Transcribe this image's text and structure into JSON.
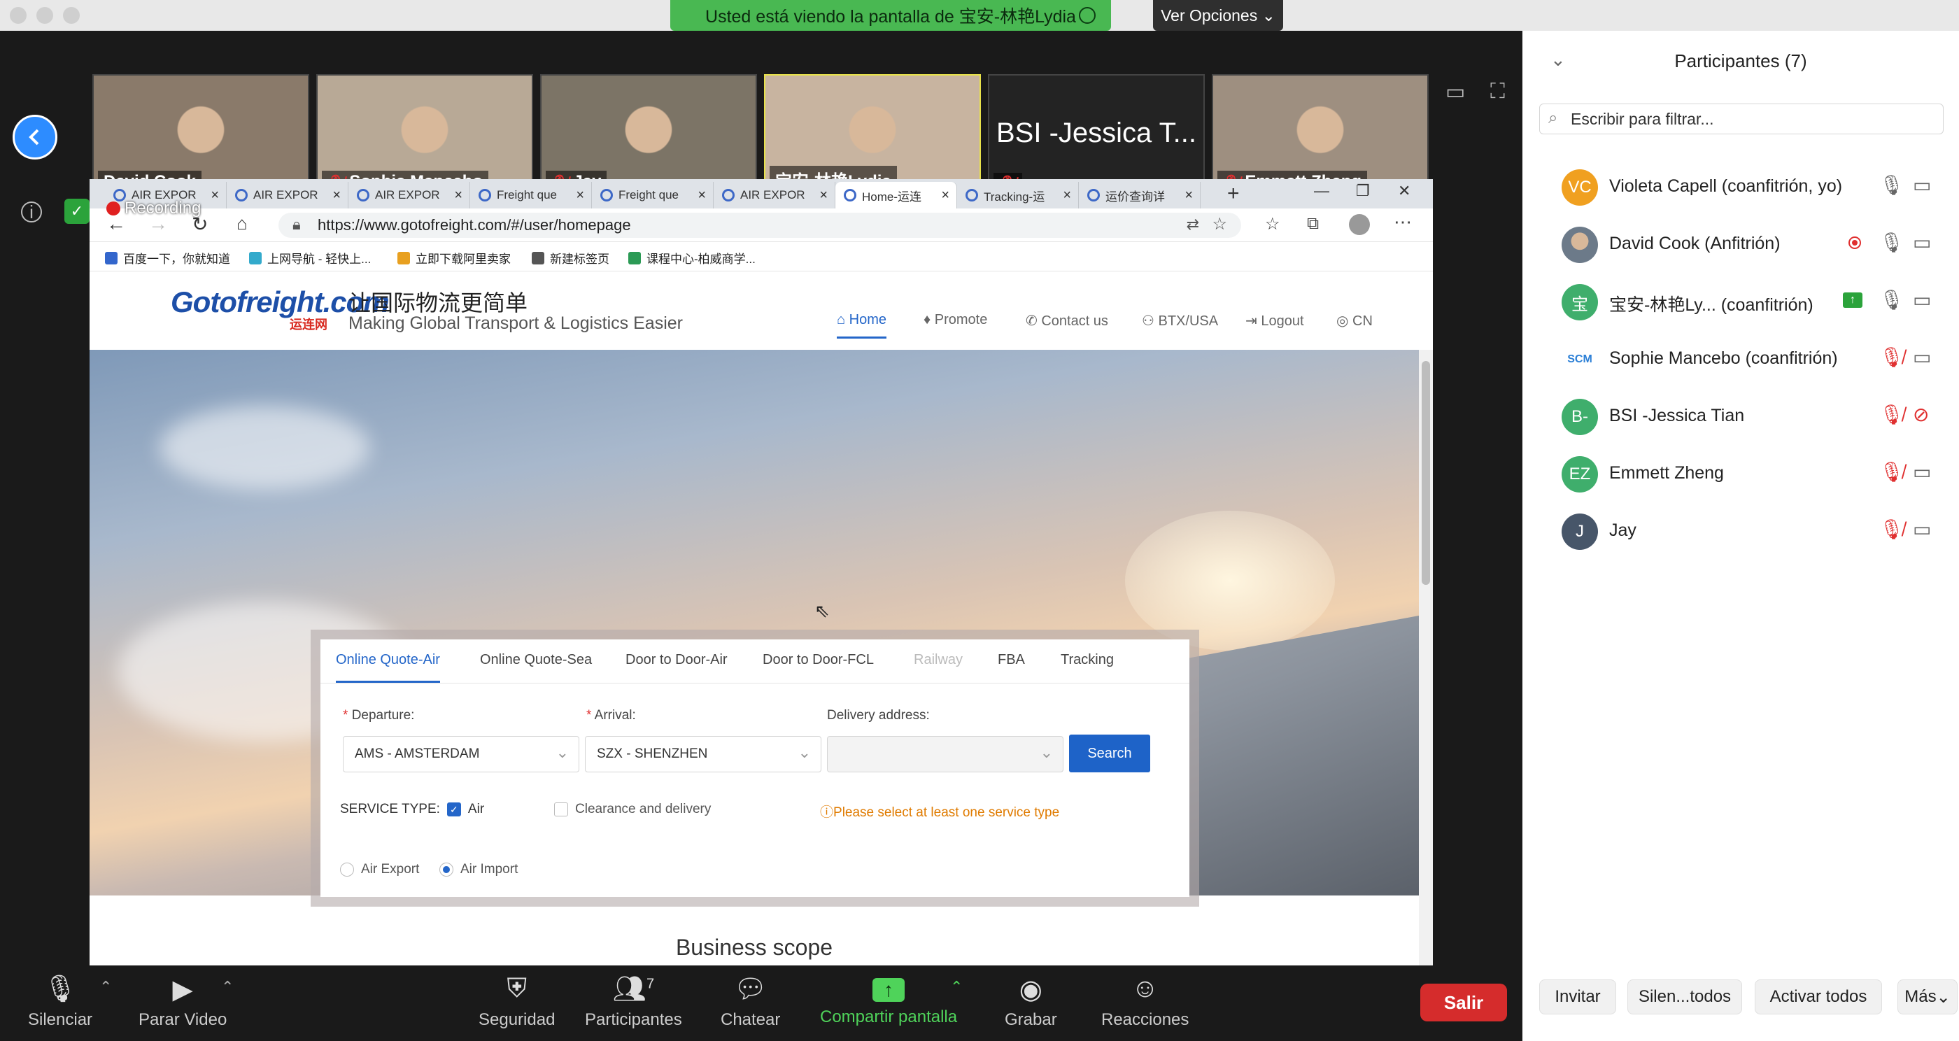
{
  "banner": {
    "text": "Usted está viendo la pantalla de 宝安-林艳Lydia",
    "options": "Ver Opciones"
  },
  "gallery": [
    {
      "name": "David Cook",
      "muted": false,
      "color": "#8a7a6a"
    },
    {
      "name": "Sophie Mancebo",
      "muted": true,
      "color": "#b8a996"
    },
    {
      "name": "Jay",
      "muted": true,
      "color": "#7c7466"
    },
    {
      "name": "宝安-林艳Lydia",
      "muted": false,
      "color": "#c8b4a0"
    },
    {
      "name": "",
      "big": "BSI -Jessica T...",
      "muted": true,
      "color": "#232323"
    },
    {
      "name": "Emmett Zheng",
      "muted": true,
      "color": "#9e8f80"
    }
  ],
  "recording": "Recording",
  "browser": {
    "tabs": [
      "AIR EXPOR",
      "AIR EXPOR",
      "AIR EXPOR",
      "Freight que",
      "Freight que",
      "AIR EXPOR",
      "Home-运连",
      "Tracking-运",
      "运价查询详"
    ],
    "url": "https://www.gotofreight.com/#/user/homepage",
    "bookmarks": [
      "百度一下，你就知道",
      "上网导航 - 轻快上...",
      "立即下载阿里卖家",
      "新建标签页",
      "课程中心-柏威商学..."
    ]
  },
  "site": {
    "logo": "Gotofreight.com",
    "logo_cn": "运连网",
    "slogan_cn": "让国际物流更简单",
    "slogan_en": "Making Global Transport & Logistics Easier",
    "nav": [
      "Home",
      "Promote",
      "Contact us",
      "BTX/USA",
      "Logout",
      "CN"
    ],
    "quote_tabs": [
      "Online Quote-Air",
      "Online Quote-Sea",
      "Door to Door-Air",
      "Door to Door-FCL",
      "Railway",
      "FBA",
      "Tracking"
    ],
    "departure_label": "Departure:",
    "departure_value": "AMS - AMSTERDAM",
    "arrival_label": "Arrival:",
    "arrival_value": "SZX - SHENZHEN",
    "delivery_label": "Delivery address:",
    "search": "Search",
    "service_type": "SERVICE TYPE:",
    "svc_air": "Air",
    "svc_clear": "Clearance and delivery",
    "warning": "Please select at least one service type",
    "air_export": "Air Export",
    "air_import": "Air Import",
    "biz_scope": "Business scope"
  },
  "toolbar": {
    "mute": "Silenciar",
    "video": "Parar Video",
    "security": "Seguridad",
    "participants": "Participantes",
    "participants_count": "7",
    "chat": "Chatear",
    "share": "Compartir pantalla",
    "record": "Grabar",
    "reactions": "Reacciones",
    "leave": "Salir"
  },
  "panel": {
    "title": "Participantes (7)",
    "filter_placeholder": "Escribir para filtrar...",
    "participants": [
      {
        "initials": "VC",
        "name": "Violeta Capell (coanfitrión, yo)",
        "color": "#f0a020",
        "mic": "on",
        "cam": "on"
      },
      {
        "initials": "",
        "name": "David Cook (Anfitrión)",
        "color": "#6c7a89",
        "mic": "on",
        "cam": "on",
        "rec": true
      },
      {
        "initials": "宝",
        "name": "宝安-林艳Ly...  (coanfitrión)",
        "color": "#3fae6c",
        "mic": "on",
        "cam": "on",
        "share": true
      },
      {
        "initials": "SCM",
        "name": "Sophie Mancebo (coanfitrión)",
        "color": "#ffffff",
        "mic": "off",
        "cam": "on"
      },
      {
        "initials": "B-",
        "name": "BSI -Jessica Tian",
        "color": "#3fae6c",
        "mic": "off",
        "cam": "off"
      },
      {
        "initials": "EZ",
        "name": "Emmett Zheng",
        "color": "#3fae6c",
        "mic": "off",
        "cam": "on"
      },
      {
        "initials": "J",
        "name": "Jay",
        "color": "#475669",
        "mic": "off",
        "cam": "on"
      }
    ],
    "buttons": [
      "Invitar",
      "Silen...todos",
      "Activar todos",
      "Más"
    ]
  }
}
